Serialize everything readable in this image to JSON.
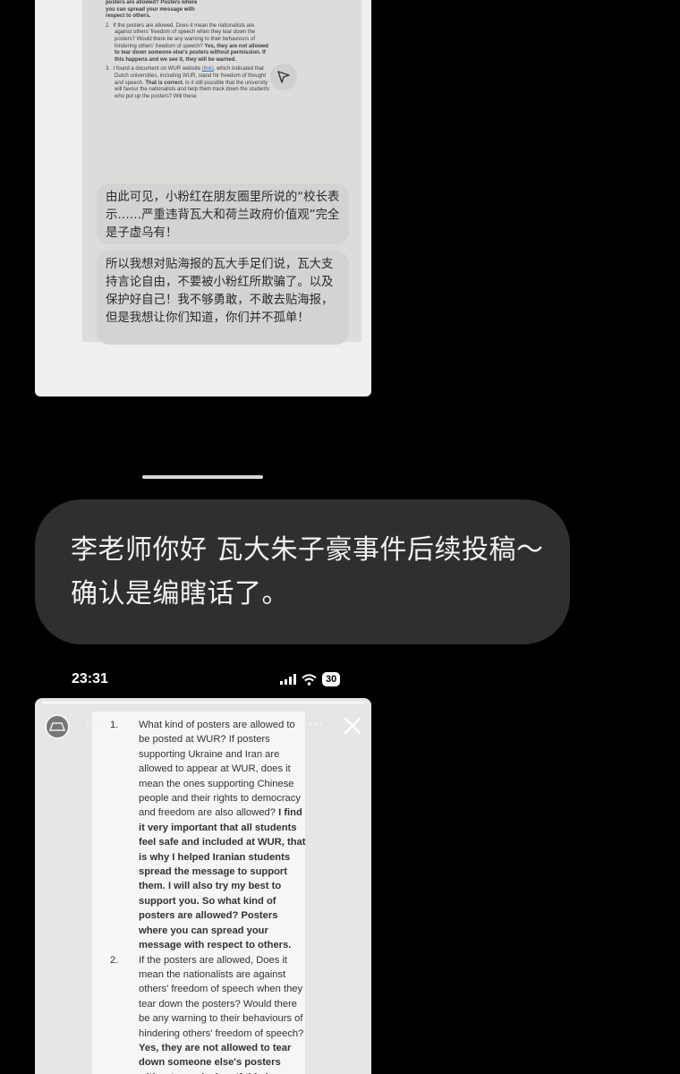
{
  "top_card": {
    "doc_lines": {
      "a": "posters are allowed? Posters where",
      "b": "you can spread your message with",
      "c": "respect to others.",
      "item2_num": "2.",
      "item2_plain": "If the posters are allowed, Does it mean the nationalists are against others' freedom of speech when they tear down the posters? Would there be any warning to their behaviours of hindering others' freedom of speech?",
      "item2_bold": "Yes, they are not allowed to tear down someone else's posters without permission. If this happens and we see it, they will be warned.",
      "item3_num": "3.",
      "item3_a": "I found a document on WUR website",
      "item3_link": "(link)",
      "item3_b": ", which indicated that Dutch universities, including WUR, stand for freedom of thought and speech.",
      "item3_bold": "That is correct.",
      "item3_c": "Is it still possible that the university will favour the nationalists and help them track down the students who put up the posters? Will these"
    },
    "bubble_1": "由此可见，小粉红在朋友圈里所说的“校长表示……严重违背瓦大和荷兰政府价值观”完全是子虚乌有！",
    "bubble_2": "所以我想对贴海报的瓦大手足们说，瓦大支持言论自由，不要被小粉红所欺骗了。以及保护好自己！我不够勇敢，不敢去贴海报，但是我想让你们知道，你们并不孤单！",
    "send_icon": "send-icon"
  },
  "message": {
    "text": "李老师你好 瓦大朱子豪事件后续投稿～确认是编瞎话了。"
  },
  "status_bar": {
    "time": "23:31",
    "battery": "30",
    "icons": [
      "signal-icon",
      "wifi-icon",
      "battery-icon"
    ]
  },
  "story": {
    "username": "nor…",
    "more": "···",
    "items": [
      {
        "num": "1.",
        "plain": "What kind of posters are allowed to be posted at WUR? If posters supporting Ukraine and Iran are allowed to appear at WUR, does it mean the ones supporting Chinese people and their rights to democracy and freedom are also allowed?",
        "bold": "I find it very important that all students feel safe and included at WUR, that is why I helped Iranian students spread the message to support them. I will also try my best to support you. So what kind of posters are allowed? Posters where you can spread your message with respect to others."
      },
      {
        "num": "2.",
        "plain": "If the posters are allowed, Does it mean the nationalists are against others' freedom of speech when they tear down the posters? Would there be any warning to their behaviours of hindering others' freedom of speech?",
        "bold": "Yes, they are not allowed to tear down someone else's posters without permission. If this happens and we"
      }
    ]
  }
}
